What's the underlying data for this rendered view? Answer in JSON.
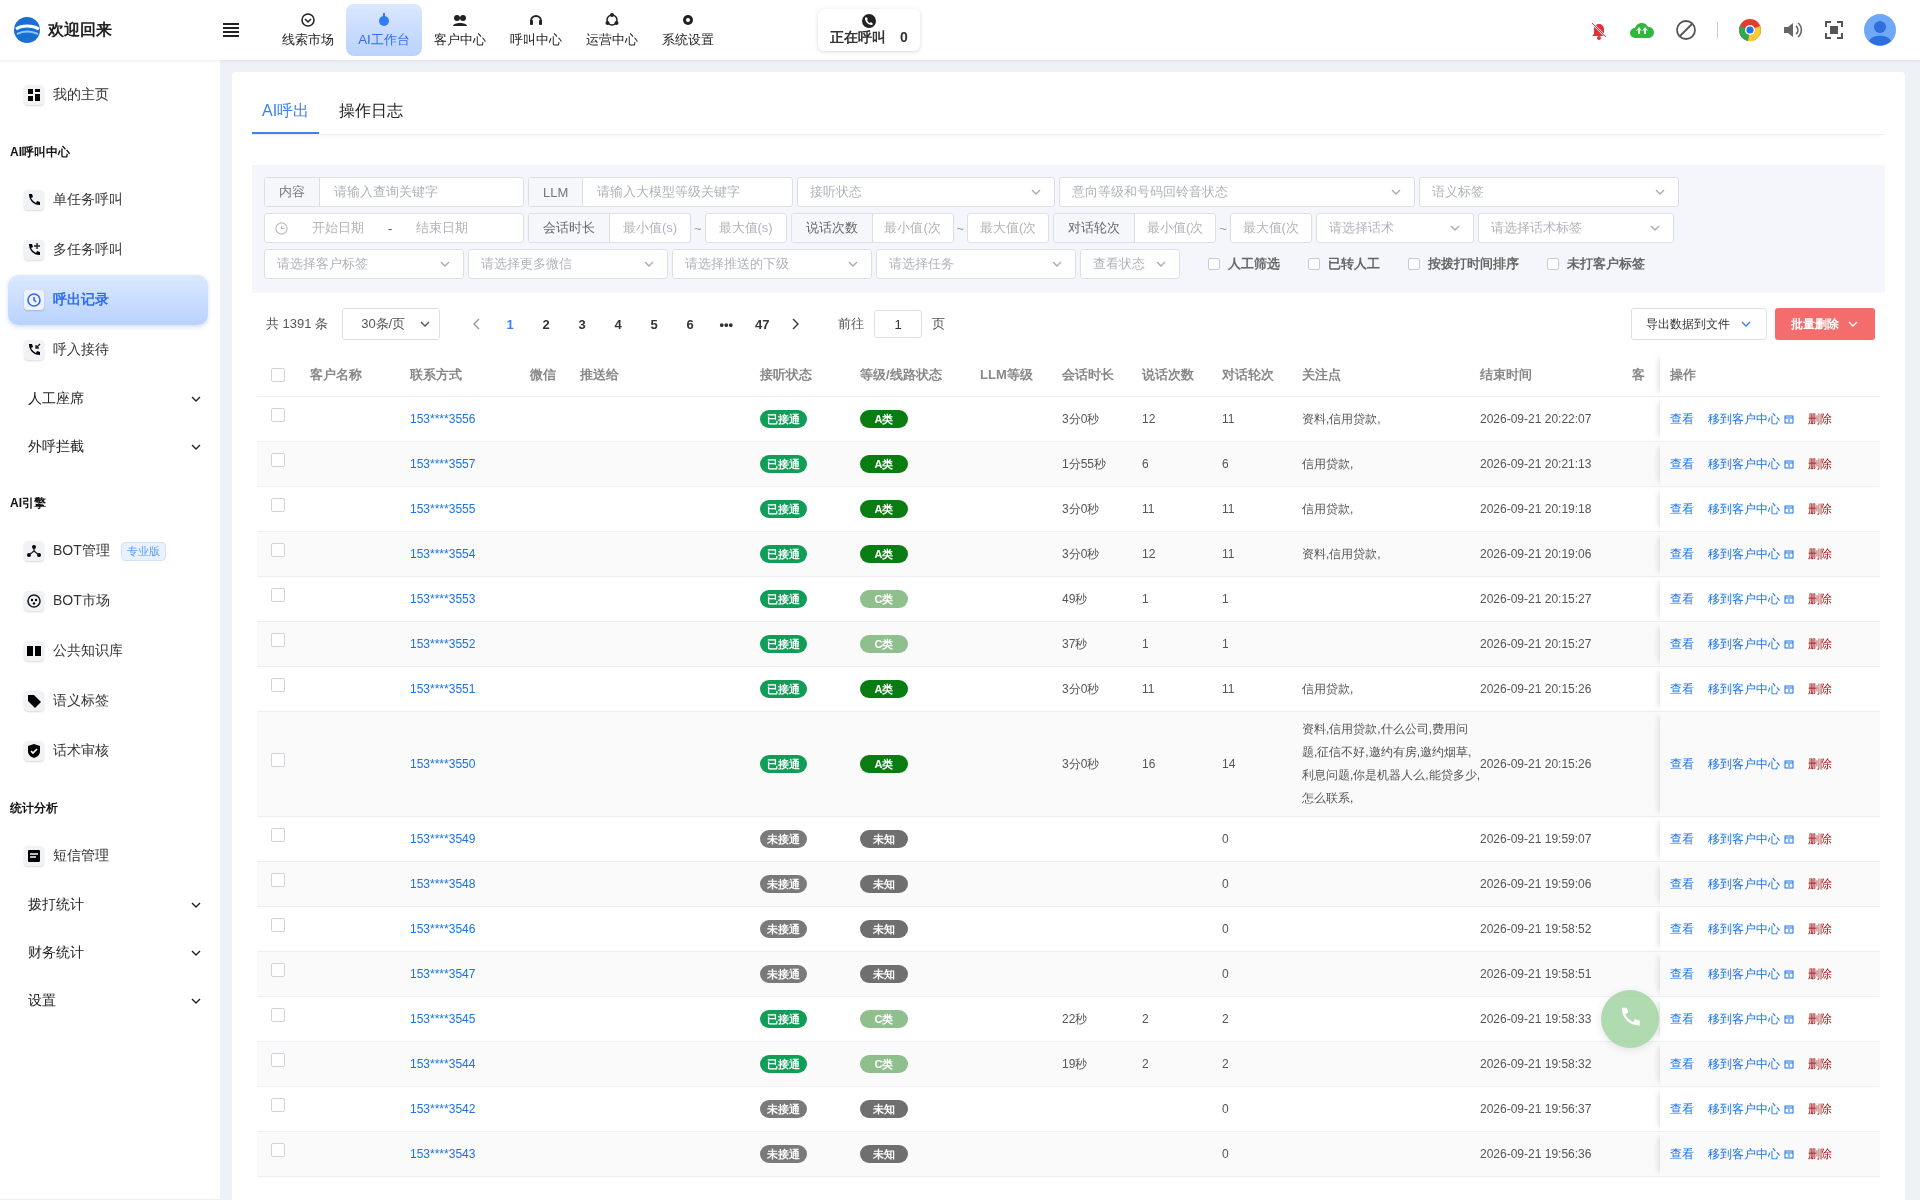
{
  "header": {
    "title": "欢迎回来",
    "nav": [
      {
        "label": "线索市场",
        "selected": false
      },
      {
        "label": "AI工作台",
        "selected": true
      },
      {
        "label": "客户中心",
        "selected": false
      },
      {
        "label": "呼叫中心",
        "selected": false
      },
      {
        "label": "运营中心",
        "selected": false
      },
      {
        "label": "系统设置",
        "selected": false
      }
    ],
    "calling": {
      "label": "正在呼叫",
      "count": "0"
    }
  },
  "sidebar": {
    "items": [
      {
        "kind": "link",
        "label": "我的主页",
        "selected": false
      },
      {
        "kind": "heading",
        "label": "AI呼叫中心"
      },
      {
        "kind": "link",
        "label": "单任务呼叫",
        "selected": false
      },
      {
        "kind": "link",
        "label": "多任务呼叫",
        "selected": false
      },
      {
        "kind": "link",
        "label": "呼出记录",
        "selected": true
      },
      {
        "kind": "link",
        "label": "呼入接待",
        "selected": false
      },
      {
        "kind": "menu",
        "label": "人工座席",
        "expanded": false
      },
      {
        "kind": "menu",
        "label": "外呼拦截",
        "expanded": false
      },
      {
        "kind": "heading",
        "label": "AI引擎"
      },
      {
        "kind": "link",
        "label": "BOT管理",
        "badge": "专业版",
        "selected": false
      },
      {
        "kind": "link",
        "label": "BOT市场",
        "selected": false
      },
      {
        "kind": "link",
        "label": "公共知识库",
        "selected": false
      },
      {
        "kind": "link",
        "label": "语义标签",
        "selected": false
      },
      {
        "kind": "link",
        "label": "话术审核",
        "selected": false
      },
      {
        "kind": "heading",
        "label": "统计分析"
      },
      {
        "kind": "link",
        "label": "短信管理",
        "selected": false
      },
      {
        "kind": "menu",
        "label": "拨打统计",
        "expanded": false
      },
      {
        "kind": "menu",
        "label": "财务统计",
        "expanded": false
      },
      {
        "kind": "menu",
        "label": "设置",
        "expanded": false
      }
    ]
  },
  "tabs": [
    {
      "label": "AI呼出",
      "selected": true
    },
    {
      "label": "操作日志",
      "selected": false
    }
  ],
  "filters": [
    {
      "kind": "labeled",
      "label": "内容",
      "placeholder": "请输入查询关键字"
    },
    {
      "kind": "labeled",
      "label": "LLM",
      "placeholder": "请输入大模型等级关键字"
    },
    {
      "kind": "select",
      "placeholder": "接听状态"
    },
    {
      "kind": "select",
      "placeholder": "意向等级和号码回铃音状态"
    },
    {
      "kind": "select",
      "placeholder": "语义标签"
    },
    {
      "kind": "daterange",
      "start": "开始日期",
      "separator": "-",
      "end": "结束日期"
    },
    {
      "kind": "range",
      "label": "会话时长",
      "min": "最小值(s)",
      "separator": "~",
      "max": "最大值(s)"
    },
    {
      "kind": "range",
      "label": "说话次数",
      "min": "最小值(次",
      "separator": "~",
      "max": "最大值(次"
    },
    {
      "kind": "range",
      "label": "对话轮次",
      "min": "最小值(次",
      "separator": "~",
      "max": "最大值(次"
    },
    {
      "kind": "select",
      "placeholder": "请选择话术"
    },
    {
      "kind": "select",
      "placeholder": "请选择话术标签"
    },
    {
      "kind": "select",
      "placeholder": "请选择客户标签"
    },
    {
      "kind": "select",
      "placeholder": "请选择更多微信"
    },
    {
      "kind": "select",
      "placeholder": "请选择推送的下级"
    },
    {
      "kind": "select",
      "placeholder": "请选择任务"
    },
    {
      "kind": "select",
      "placeholder": "查看状态"
    },
    {
      "kind": "checkbox",
      "label": "人工筛选",
      "checked": false
    },
    {
      "kind": "checkbox",
      "label": "已转人工",
      "checked": false
    },
    {
      "kind": "checkbox",
      "label": "按拨打时间排序",
      "checked": false
    },
    {
      "kind": "checkbox",
      "label": "未打客户标签",
      "checked": false
    }
  ],
  "pager": {
    "total": "共 1391 条",
    "page_size": "30条/页",
    "pages": [
      {
        "label": "1",
        "selected": true
      },
      {
        "label": "2",
        "selected": false
      },
      {
        "label": "3",
        "selected": false
      },
      {
        "label": "4",
        "selected": false
      },
      {
        "label": "5",
        "selected": false
      },
      {
        "label": "6",
        "selected": false
      },
      {
        "label": "•••",
        "selected": false
      },
      {
        "label": "47",
        "selected": false
      }
    ],
    "goto_label": "前往",
    "goto_value": "1",
    "goto_unit": "页"
  },
  "toolbar": {
    "export": "导出数据到文件",
    "bulk_delete": "批量删除"
  },
  "table": {
    "header_checked": false,
    "columns": [
      "客户名称",
      "联系方式",
      "微信",
      "推送给",
      "接听状态",
      "等级/线路状态",
      "LLM等级",
      "会话时长",
      "说话次数",
      "对话轮次",
      "关注点",
      "结束时间",
      "客",
      "操作"
    ],
    "rows": [
      {
        "checked": false,
        "phone": "153****3556",
        "call_status": {
          "text": "已接通",
          "color": "#0f9d58"
        },
        "grade": {
          "text": "A类",
          "color": "#0a7d12"
        },
        "duration": "3分0秒",
        "utterances": "12",
        "turns": "11",
        "focus": "资料,信用贷款,",
        "end_time": "2026-09-21 20:22:07",
        "actions": [
          "查看",
          "移到客户中心",
          "删除"
        ]
      },
      {
        "checked": false,
        "phone": "153****3557",
        "call_status": {
          "text": "已接通",
          "color": "#0f9d58"
        },
        "grade": {
          "text": "A类",
          "color": "#0a7d12"
        },
        "duration": "1分55秒",
        "utterances": "6",
        "turns": "6",
        "focus": "信用贷款,",
        "end_time": "2026-09-21 20:21:13",
        "actions": [
          "查看",
          "移到客户中心",
          "删除"
        ]
      },
      {
        "checked": false,
        "phone": "153****3555",
        "call_status": {
          "text": "已接通",
          "color": "#0f9d58"
        },
        "grade": {
          "text": "A类",
          "color": "#0a7d12"
        },
        "duration": "3分0秒",
        "utterances": "11",
        "turns": "11",
        "focus": "信用贷款,",
        "end_time": "2026-09-21 20:19:18",
        "actions": [
          "查看",
          "移到客户中心",
          "删除"
        ]
      },
      {
        "checked": false,
        "phone": "153****3554",
        "call_status": {
          "text": "已接通",
          "color": "#0f9d58"
        },
        "grade": {
          "text": "A类",
          "color": "#0a7d12"
        },
        "duration": "3分0秒",
        "utterances": "12",
        "turns": "11",
        "focus": "资料,信用贷款,",
        "end_time": "2026-09-21 20:19:06",
        "actions": [
          "查看",
          "移到客户中心",
          "删除"
        ]
      },
      {
        "checked": false,
        "phone": "153****3553",
        "call_status": {
          "text": "已接通",
          "color": "#0f9d58"
        },
        "grade": {
          "text": "C类",
          "color": "#8fbf8c"
        },
        "duration": "49秒",
        "utterances": "1",
        "turns": "1",
        "end_time": "2026-09-21 20:15:27",
        "actions": [
          "查看",
          "移到客户中心",
          "删除"
        ]
      },
      {
        "checked": false,
        "phone": "153****3552",
        "call_status": {
          "text": "已接通",
          "color": "#0f9d58"
        },
        "grade": {
          "text": "C类",
          "color": "#8fbf8c"
        },
        "duration": "37秒",
        "utterances": "1",
        "turns": "1",
        "end_time": "2026-09-21 20:15:27",
        "actions": [
          "查看",
          "移到客户中心",
          "删除"
        ]
      },
      {
        "checked": false,
        "phone": "153****3551",
        "call_status": {
          "text": "已接通",
          "color": "#0f9d58"
        },
        "grade": {
          "text": "A类",
          "color": "#0a7d12"
        },
        "duration": "3分0秒",
        "utterances": "11",
        "turns": "11",
        "focus": "信用贷款,",
        "end_time": "2026-09-21 20:15:26",
        "actions": [
          "查看",
          "移到客户中心",
          "删除"
        ]
      },
      {
        "checked": false,
        "phone": "153****3550",
        "call_status": {
          "text": "已接通",
          "color": "#0f9d58"
        },
        "grade": {
          "text": "A类",
          "color": "#0a7d12"
        },
        "duration": "3分0秒",
        "utterances": "16",
        "turns": "14",
        "focus": "资料,信用贷款,什么公司,费用问题,征信不好,邀约有房,邀约烟草,利息问题,你是机器人么,能贷多少,怎么联系,",
        "end_time": "2026-09-21 20:15:26",
        "actions": [
          "查看",
          "移到客户中心",
          "删除"
        ]
      },
      {
        "checked": false,
        "phone": "153****3549",
        "call_status": {
          "text": "未接通",
          "color": "#7a7a7a"
        },
        "grade": {
          "text": "未知",
          "color": "#6f6f6f"
        },
        "turns": "0",
        "end_time": "2026-09-21 19:59:07",
        "actions": [
          "查看",
          "移到客户中心",
          "删除"
        ]
      },
      {
        "checked": false,
        "phone": "153****3548",
        "call_status": {
          "text": "未接通",
          "color": "#7a7a7a"
        },
        "grade": {
          "text": "未知",
          "color": "#6f6f6f"
        },
        "turns": "0",
        "end_time": "2026-09-21 19:59:06",
        "actions": [
          "查看",
          "移到客户中心",
          "删除"
        ]
      },
      {
        "checked": false,
        "phone": "153****3546",
        "call_status": {
          "text": "未接通",
          "color": "#7a7a7a"
        },
        "grade": {
          "text": "未知",
          "color": "#6f6f6f"
        },
        "turns": "0",
        "end_time": "2026-09-21 19:58:52",
        "actions": [
          "查看",
          "移到客户中心",
          "删除"
        ]
      },
      {
        "checked": false,
        "phone": "153****3547",
        "call_status": {
          "text": "未接通",
          "color": "#7a7a7a"
        },
        "grade": {
          "text": "未知",
          "color": "#6f6f6f"
        },
        "turns": "0",
        "end_time": "2026-09-21 19:58:51",
        "actions": [
          "查看",
          "移到客户中心",
          "删除"
        ]
      },
      {
        "checked": false,
        "phone": "153****3545",
        "call_status": {
          "text": "已接通",
          "color": "#0f9d58"
        },
        "grade": {
          "text": "C类",
          "color": "#8fbf8c"
        },
        "duration": "22秒",
        "utterances": "2",
        "turns": "2",
        "end_time": "2026-09-21 19:58:33",
        "actions": [
          "查看",
          "移到客户中心",
          "删除"
        ]
      },
      {
        "checked": false,
        "phone": "153****3544",
        "call_status": {
          "text": "已接通",
          "color": "#0f9d58"
        },
        "grade": {
          "text": "C类",
          "color": "#8fbf8c"
        },
        "duration": "19秒",
        "utterances": "2",
        "turns": "2",
        "end_time": "2026-09-21 19:58:32",
        "actions": [
          "查看",
          "移到客户中心",
          "删除"
        ]
      },
      {
        "checked": false,
        "phone": "153****3542",
        "call_status": {
          "text": "未接通",
          "color": "#7a7a7a"
        },
        "grade": {
          "text": "未知",
          "color": "#6f6f6f"
        },
        "turns": "0",
        "end_time": "2026-09-21 19:56:37",
        "actions": [
          "查看",
          "移到客户中心",
          "删除"
        ]
      },
      {
        "checked": false,
        "phone": "153****3543",
        "call_status": {
          "text": "未接通",
          "color": "#7a7a7a"
        },
        "grade": {
          "text": "未知",
          "color": "#6f6f6f"
        },
        "turns": "0",
        "end_time": "2026-09-21 19:56:36",
        "actions": [
          "查看",
          "移到客户中心",
          "删除"
        ]
      }
    ]
  }
}
